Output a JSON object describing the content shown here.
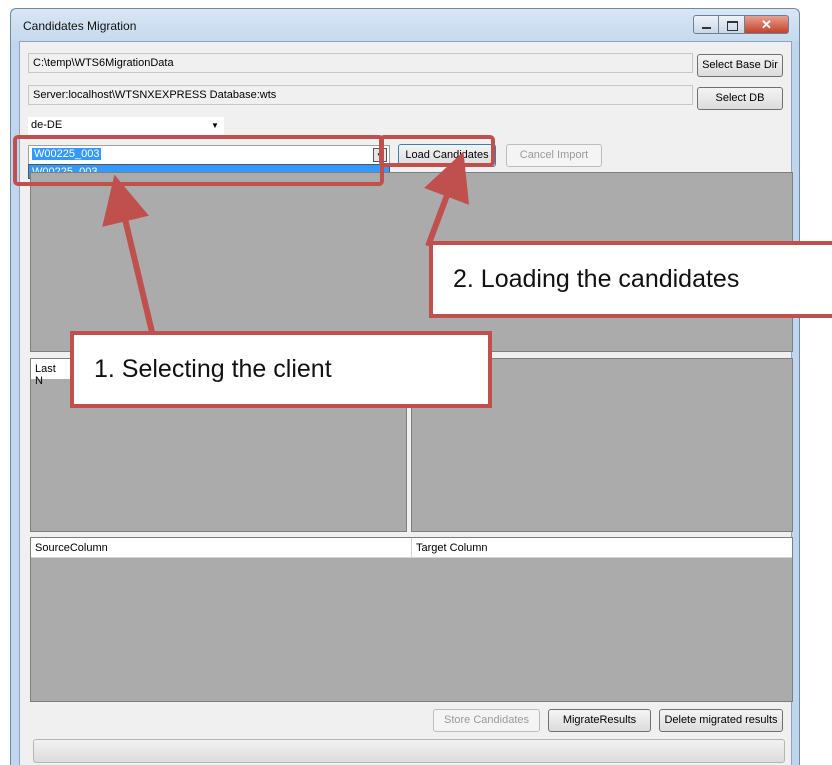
{
  "window": {
    "title": "Candidates Migration",
    "close_glyph": "✕"
  },
  "settings": {
    "base_dir_path": "C:\\temp\\WTS6MigrationData",
    "select_base_dir_label": "Select Base Dir",
    "db_connection": "Server:localhost\\WTSNXEXPRESS Database:wts",
    "select_db_label": "Select DB",
    "culture_value": "de-DE"
  },
  "client_select": {
    "value": "W00225_003",
    "dropdown_options": [
      "W00225_003"
    ]
  },
  "toolbar": {
    "load_candidates_label": "Load Candidates",
    "cancel_import_label": "Cancel Import"
  },
  "grid_lastname": {
    "header_prefix": "Last N"
  },
  "mapping_grid": {
    "columns": [
      "SourceColumn",
      "Target Column"
    ]
  },
  "actions": {
    "store_candidates_label": "Store Candidates",
    "migrate_results_label": "MigrateResults",
    "delete_migrated_label": "Delete migrated results"
  },
  "annotations": {
    "step1": "1. Selecting the client",
    "step2": "2. Loading the candidates",
    "color": "#c0504d"
  },
  "icons": {
    "dropdown_arrow": "▼"
  }
}
